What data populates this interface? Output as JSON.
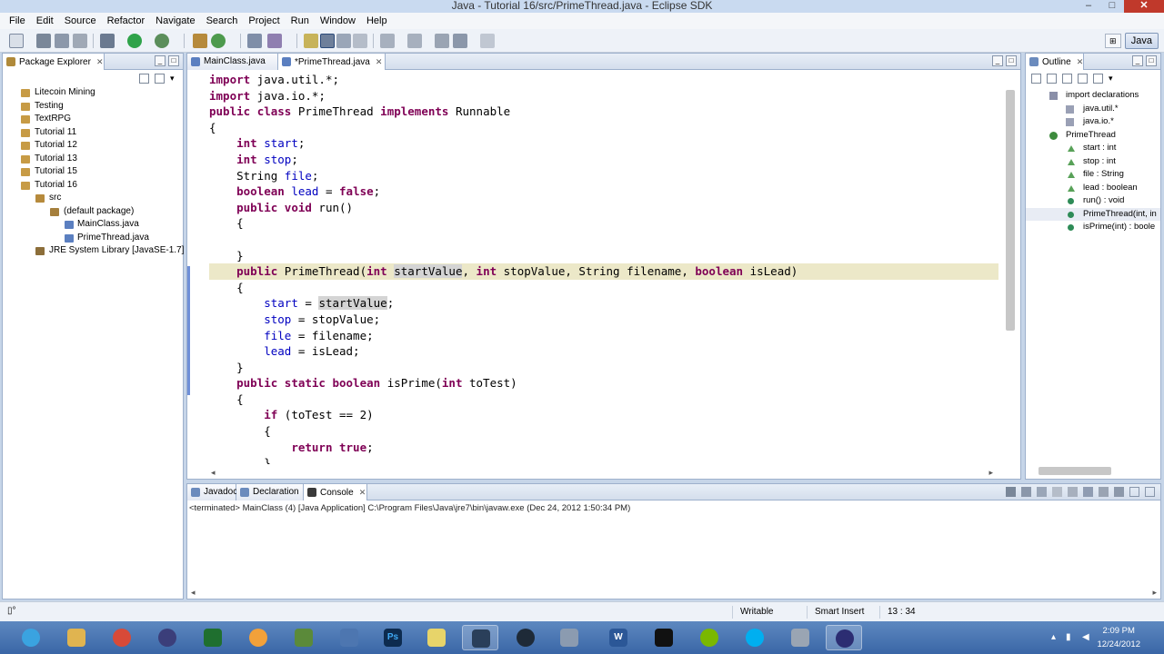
{
  "window": {
    "title": "Java - Tutorial 16/src/PrimeThread.java - Eclipse SDK"
  },
  "menu": [
    "File",
    "Edit",
    "Source",
    "Refactor",
    "Navigate",
    "Search",
    "Project",
    "Run",
    "Window",
    "Help"
  ],
  "perspective": {
    "label": "Java"
  },
  "package_explorer": {
    "tab": "Package Explorer",
    "items": [
      {
        "label": "Litecoin Mining",
        "icon": "project-icon"
      },
      {
        "label": "Testing",
        "icon": "project-icon"
      },
      {
        "label": "TextRPG",
        "icon": "project-icon"
      },
      {
        "label": "Tutorial 11",
        "icon": "project-icon"
      },
      {
        "label": "Tutorial 12",
        "icon": "project-icon"
      },
      {
        "label": "Tutorial 13",
        "icon": "project-icon"
      },
      {
        "label": "Tutorial 15",
        "icon": "project-icon"
      },
      {
        "label": "Tutorial 16",
        "icon": "project-icon"
      },
      {
        "label": "src",
        "icon": "source-folder-icon"
      },
      {
        "label": "(default package)",
        "icon": "package-icon"
      },
      {
        "label": "MainClass.java",
        "icon": "java-file-icon"
      },
      {
        "label": "PrimeThread.java",
        "icon": "java-file-icon"
      },
      {
        "label": "JRE System Library [JavaSE-1.7]",
        "icon": "library-icon"
      }
    ]
  },
  "editor": {
    "tabs": [
      {
        "label": "MainClass.java"
      },
      {
        "label": "*PrimeThread.java"
      }
    ],
    "cursor_position": "13 : 34"
  },
  "outline": {
    "tab": "Outline",
    "items": [
      {
        "label": "import declarations",
        "icon": "imports-icon"
      },
      {
        "label": "java.util.*",
        "icon": "import-icon"
      },
      {
        "label": "java.io.*",
        "icon": "import-icon"
      },
      {
        "label": "PrimeThread",
        "icon": "class-icon"
      },
      {
        "label": "start : int",
        "icon": "field-icon"
      },
      {
        "label": "stop : int",
        "icon": "field-icon"
      },
      {
        "label": "file : String",
        "icon": "field-icon"
      },
      {
        "label": "lead : boolean",
        "icon": "field-icon"
      },
      {
        "label": "run() : void",
        "icon": "method-icon"
      },
      {
        "label": "PrimeThread(int, in",
        "icon": "constructor-icon"
      },
      {
        "label": "isPrime(int) : boole",
        "icon": "static-method-icon"
      }
    ]
  },
  "bottom": {
    "tabs": [
      {
        "label": "Javadoc"
      },
      {
        "label": "Declaration"
      },
      {
        "label": "Console"
      }
    ],
    "console_header": "<terminated> MainClass (4) [Java Application] C:\\Program Files\\Java\\jre7\\bin\\javaw.exe (Dec 24, 2012 1:50:34 PM)"
  },
  "status": {
    "writable": "Writable",
    "insert_mode": "Smart Insert",
    "position": "13 : 34"
  },
  "taskbar": {
    "time": "2:09 PM",
    "date": "12/24/2012"
  },
  "colors": {
    "keyword": "#7f0055",
    "field": "#0000c0",
    "highlight": "#d4d4d4",
    "selection_bar": "#6f8fd8"
  }
}
